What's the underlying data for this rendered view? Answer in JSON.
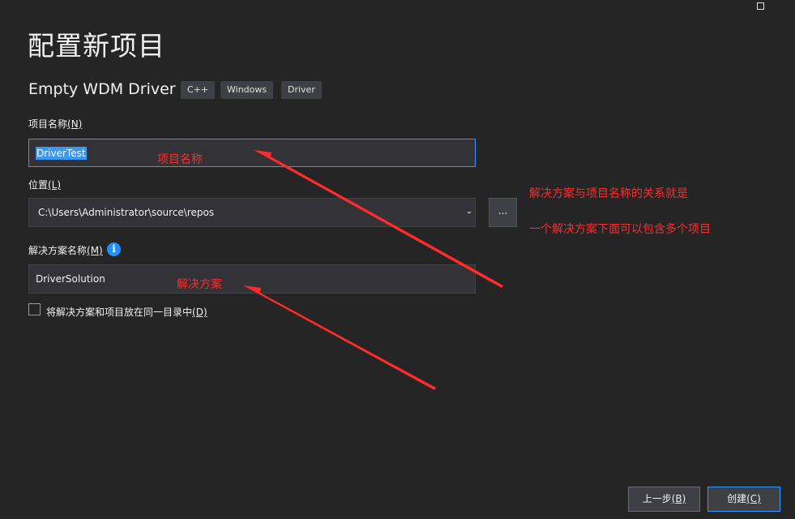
{
  "title": "配置新项目",
  "template": {
    "name": "Empty WDM Driver",
    "tags": [
      "C++",
      "Windows",
      "Driver"
    ]
  },
  "project_name": {
    "label": "项目名称",
    "mnemonic": "(N)",
    "value": "DriverTest"
  },
  "location": {
    "label": "位置",
    "mnemonic": "(L)",
    "value": "C:\\Users\\Administrator\\source\\repos",
    "browse_label": "..."
  },
  "solution_name": {
    "label": "解决方案名称",
    "mnemonic": "(M)",
    "info_icon": "i",
    "value": "DriverSolution"
  },
  "same_dir_checkbox": {
    "label": "将解决方案和项目放在同一目录中",
    "mnemonic": "(D)",
    "checked": false
  },
  "buttons": {
    "back_label": "上一步",
    "back_mnemonic": "(B)",
    "create_label": "创建",
    "create_mnemonic": "(C)"
  },
  "annotations": {
    "project_name_note": "项目名称",
    "solution_note": "解决方案",
    "relation_line1": "解决方案与项目名称的关系就是",
    "relation_line2": "一个解决方案下面可以包含多个项目",
    "color": "#ff2a2a"
  },
  "colors": {
    "background": "#252526",
    "field": "#333337",
    "accent": "#3399ff"
  }
}
